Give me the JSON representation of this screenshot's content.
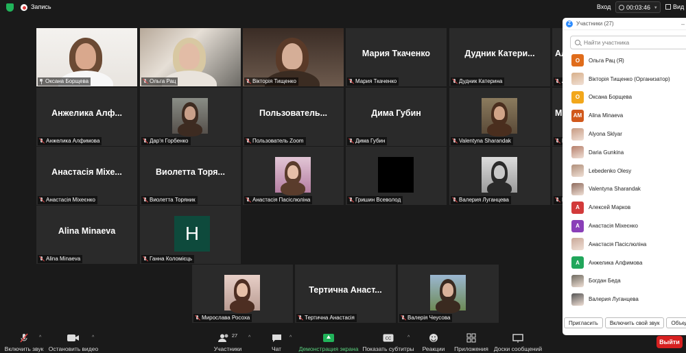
{
  "topbar": {
    "recording_label": "Запись",
    "signin_label": "Вход",
    "timer": "00:03:46",
    "view_label": "Вид"
  },
  "tiles": [
    {
      "label": "Оксана Борщева",
      "big": "",
      "speaking": true,
      "pinned": true
    },
    {
      "label": "Ольга Рац",
      "big": ""
    },
    {
      "label": "Вікторія Тищенко",
      "big": ""
    },
    {
      "label": "Мария Ткаченко",
      "big": "Мария Ткаченко"
    },
    {
      "label": "Дудник Катерина",
      "big": "Дудник Катери..."
    },
    {
      "label": "Алексей Марков",
      "big": "Алексей Марков"
    },
    {
      "label": "Анжелика Алфимова",
      "big": "Анжелика Алф..."
    },
    {
      "label": "Дар'я Горбенко",
      "big": ""
    },
    {
      "label": "Пользователь Zoom",
      "big": "Пользователь..."
    },
    {
      "label": "Дима Губин",
      "big": "Дима Губин"
    },
    {
      "label": "Valentyna Sharandak",
      "big": ""
    },
    {
      "label": "Мамед Набиев",
      "big": "Мамед Набиев"
    },
    {
      "label": "Анастасія Міхеєнко",
      "big": "Анастасія Міхе..."
    },
    {
      "label": "Виолетта Торяник",
      "big": "Виолетта Торя..."
    },
    {
      "label": "Анастасія Пасіслюліна",
      "big": ""
    },
    {
      "label": "Гришин Всеволод",
      "big": ""
    },
    {
      "label": "Валерия Луганцева",
      "big": ""
    },
    {
      "label": "Lebedenko Olesy",
      "big": ""
    },
    {
      "label": "Alina Minaeva",
      "big": "Alina Minaeva"
    },
    {
      "label": "Ганна Коломієць",
      "big": "",
      "letter": "H"
    },
    {
      "label": "Мирослава Росоха",
      "big": ""
    },
    {
      "label": "Тертична Анастасія",
      "big": "Тертична Анаст..."
    },
    {
      "label": "Валерія Чеусова",
      "big": ""
    }
  ],
  "panel": {
    "title": "Участники (27)",
    "search_placeholder": "Найти участника",
    "participants": [
      {
        "initials": "О",
        "color": "#e06c1b",
        "name": "Ольга Рац (Я)"
      },
      {
        "initials": "",
        "color": "#d8b08a",
        "name": "Вікторія Тищенко (Организатор)"
      },
      {
        "initials": "О",
        "color": "#f2a71b",
        "name": "Оксана Борщева"
      },
      {
        "initials": "AM",
        "color": "#d1581b",
        "name": "Alina Minaeva"
      },
      {
        "initials": "",
        "color": "#c79a82",
        "name": "Alyona Sklyar"
      },
      {
        "initials": "",
        "color": "#b67f6b",
        "name": "Daria Gunkina"
      },
      {
        "initials": "",
        "color": "#b08f7a",
        "name": "Lebedenko Olesy"
      },
      {
        "initials": "",
        "color": "#8f6c5e",
        "name": "Valentyna Sharandak"
      },
      {
        "initials": "А",
        "color": "#d23a3a",
        "name": "Алексей Марков"
      },
      {
        "initials": "А",
        "color": "#8a3fb8",
        "name": "Анастасія Міхеєнко"
      },
      {
        "initials": "",
        "color": "#c9a899",
        "name": "Анастасія Пасіслюліна"
      },
      {
        "initials": "А",
        "color": "#21a65b",
        "name": "Анжелика Алфимова"
      },
      {
        "initials": "",
        "color": "#6e6a60",
        "name": "Богдан Беда"
      },
      {
        "initials": "",
        "color": "#555",
        "name": "Валерия Луганцева"
      }
    ],
    "invite_label": "Пригласить",
    "unmute_label": "Включить свой звук",
    "more_label": "Объед"
  },
  "toolbar": {
    "unmute": "Включить звук",
    "stop_video": "Остановить видео",
    "participants": "Участники",
    "participants_count": "27",
    "chat": "Чат",
    "share": "Демонстрация экрана",
    "captions": "Показать субтитры",
    "reactions": "Реакции",
    "apps": "Приложения",
    "whiteboards": "Доски сообщений",
    "leave": "Выйти"
  }
}
